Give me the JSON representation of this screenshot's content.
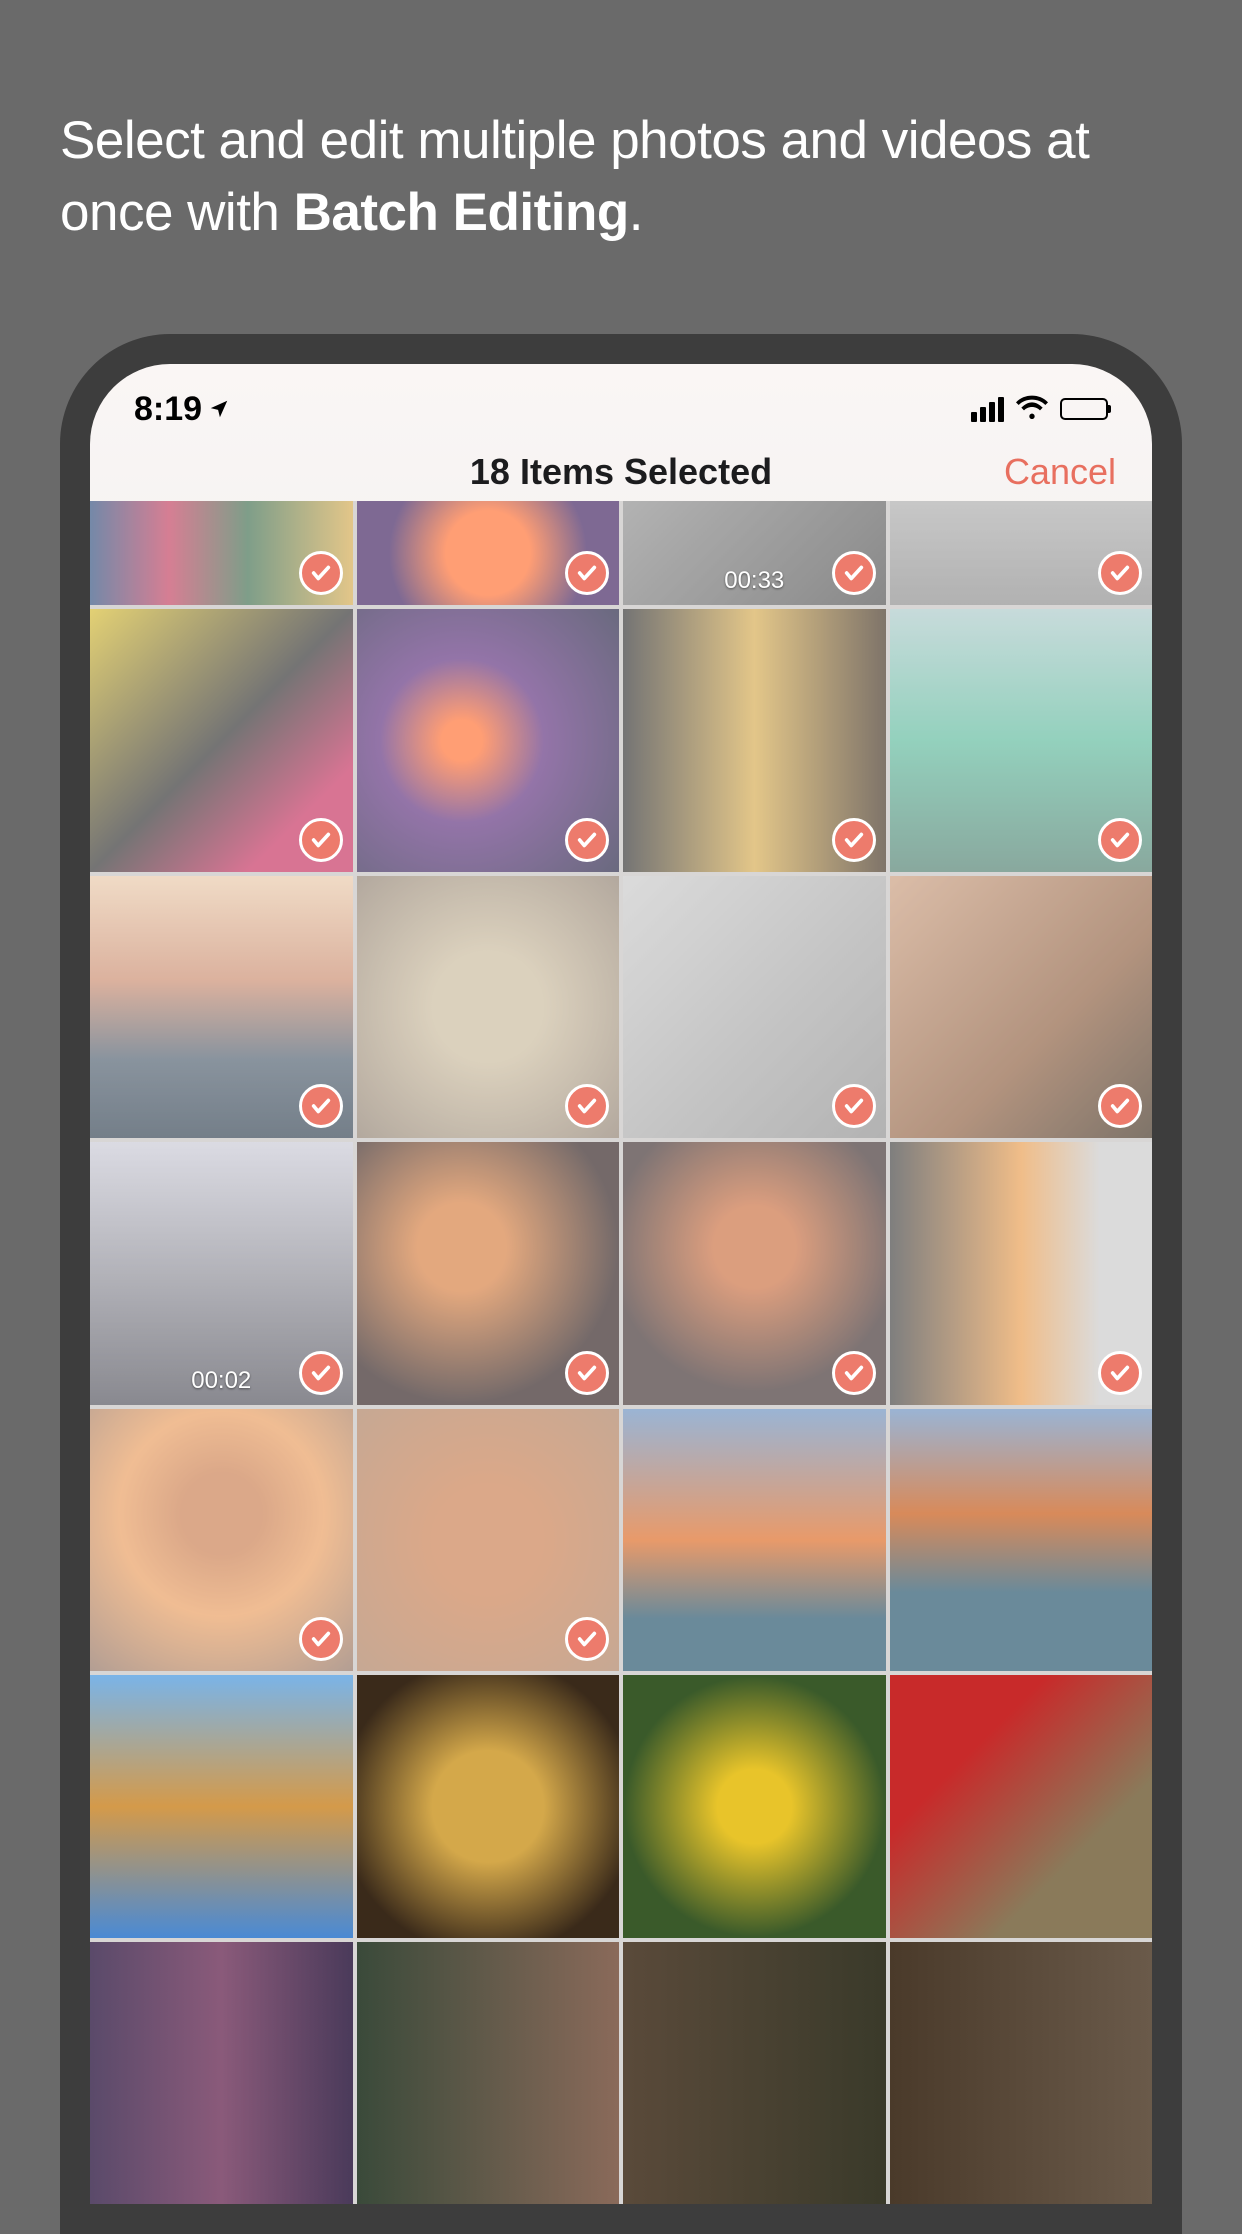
{
  "promo": {
    "text_regular": "Select and edit multiple photos and videos at once with ",
    "text_bold": "Batch Editing",
    "text_suffix": "."
  },
  "status_bar": {
    "time": "8:19"
  },
  "nav": {
    "title": "18 Items Selected",
    "cancel": "Cancel"
  },
  "accent_color": "#ed7b6c",
  "grid": {
    "rows": [
      {
        "first_row": true,
        "cells": [
          {
            "selected": true,
            "duration": null
          },
          {
            "selected": true,
            "duration": null
          },
          {
            "selected": true,
            "duration": "00:33"
          },
          {
            "selected": true,
            "duration": null
          }
        ]
      },
      {
        "cells": [
          {
            "selected": true,
            "duration": null
          },
          {
            "selected": true,
            "duration": null
          },
          {
            "selected": true,
            "duration": null
          },
          {
            "selected": true,
            "duration": null
          }
        ]
      },
      {
        "cells": [
          {
            "selected": true,
            "duration": null
          },
          {
            "selected": true,
            "duration": null
          },
          {
            "selected": true,
            "duration": null
          },
          {
            "selected": true,
            "duration": null
          }
        ]
      },
      {
        "cells": [
          {
            "selected": true,
            "duration": "00:02"
          },
          {
            "selected": true,
            "duration": null
          },
          {
            "selected": true,
            "duration": null
          },
          {
            "selected": true,
            "duration": null
          }
        ]
      },
      {
        "cells": [
          {
            "selected": true,
            "duration": null
          },
          {
            "selected": true,
            "duration": null
          },
          {
            "selected": false,
            "duration": null
          },
          {
            "selected": false,
            "duration": null
          }
        ]
      },
      {
        "cells": [
          {
            "selected": false,
            "duration": null
          },
          {
            "selected": false,
            "duration": null
          },
          {
            "selected": false,
            "duration": null
          },
          {
            "selected": false,
            "duration": null
          }
        ]
      },
      {
        "cells": [
          {
            "selected": false,
            "duration": null
          },
          {
            "selected": false,
            "duration": null
          },
          {
            "selected": false,
            "duration": null
          },
          {
            "selected": false,
            "duration": null
          }
        ]
      }
    ]
  }
}
